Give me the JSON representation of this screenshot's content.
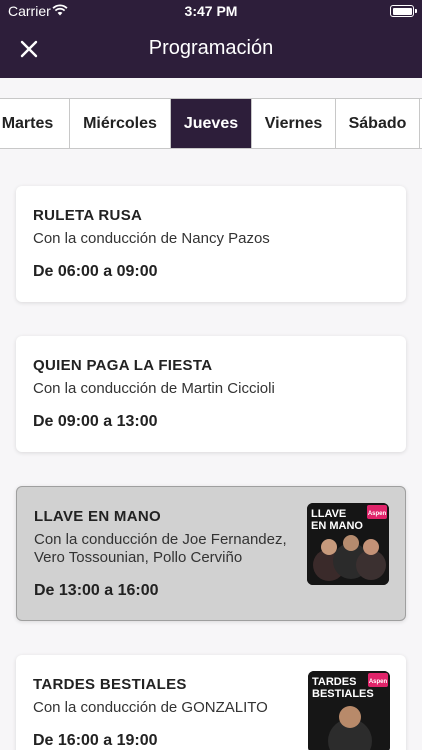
{
  "status_bar": {
    "carrier": "Carrier",
    "time": "3:47 PM"
  },
  "header": {
    "title": "Programación",
    "close_icon": "close-icon"
  },
  "tabs": [
    {
      "label": "Martes"
    },
    {
      "label": "Miércoles"
    },
    {
      "label": "Jueves",
      "active": true
    },
    {
      "label": "Viernes"
    },
    {
      "label": "Sábado"
    }
  ],
  "programs": [
    {
      "name": "RULETA RUSA",
      "host": "Con la conducción de Nancy Pazos",
      "hours": "De 06:00 a 09:00"
    },
    {
      "name": "QUIEN PAGA LA FIESTA",
      "host": "Con la conducción de Martin Ciccioli",
      "hours": "De 09:00 a 13:00"
    },
    {
      "name": "LLAVE EN MANO",
      "host_line1": "Con la conducción de Joe Fernandez,",
      "host_line2": "Vero Tossounian, Pollo Cerviño",
      "hours": "De 13:00 a 16:00",
      "thumb_title_1": "LLAVE",
      "thumb_title_2": "EN MANO",
      "thumb_badge": "Aspen",
      "highlighted": true
    },
    {
      "name": "TARDES BESTIALES",
      "host": "Con la conducción de GONZALITO",
      "hours": "De 16:00 a 19:00",
      "thumb_title_1": "TARDES",
      "thumb_title_2": "BESTIALES",
      "thumb_badge": "Aspen"
    }
  ],
  "colors": {
    "header_bg": "#2d1e3a",
    "active_tab": "#2d1e3a",
    "highlight_card": "#d1d1d1",
    "badge": "#e0246a"
  }
}
